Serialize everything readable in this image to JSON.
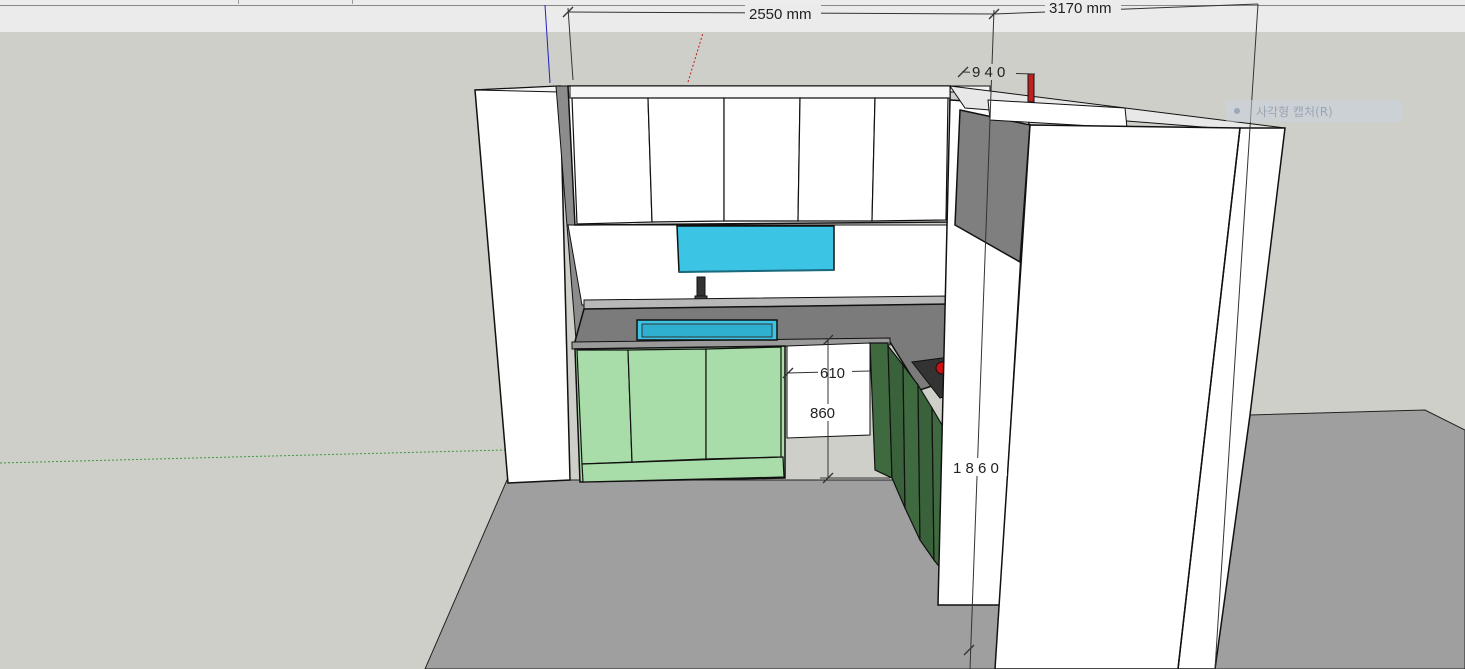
{
  "dimensions": {
    "total_width": "2550 mm",
    "side_depth": "3170 mm",
    "top_depth": "9 4 0",
    "counter_depth": "610",
    "counter_height": "860",
    "fridge_height": "1 8 6 0"
  },
  "tooltip": {
    "label": "사각형 캡처(R)",
    "icon": "capture-icon"
  },
  "colors": {
    "lower_cabinet": "#a8dca8",
    "dark_cabinet": "#3f6a3f",
    "backsplash_glass": "#3bc4e4",
    "countertop": "#7a7a7a",
    "floor": "#9e9e9e",
    "background": "#cfcfca"
  }
}
